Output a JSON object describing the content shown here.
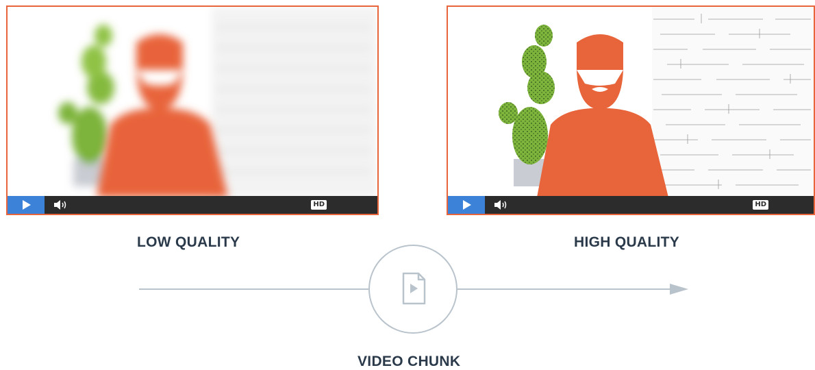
{
  "players": [
    {
      "id": "low",
      "hd_label": "HD"
    },
    {
      "id": "high",
      "hd_label": "HD"
    }
  ],
  "labels": {
    "low": "LOW QUALITY",
    "high": "HIGH QUALITY",
    "chunk": "VIDEO CHUNK"
  },
  "icons": {
    "play": "play-icon",
    "volume": "volume-icon",
    "video_file": "video-file-icon",
    "arrow": "arrow-right-icon"
  },
  "colors": {
    "accent_orange": "#e8643a",
    "cactus_green": "#7db43b",
    "play_blue": "#3c82d8",
    "control_bar": "#2c2c2c",
    "label_text": "#2b3a4a",
    "timeline_gray": "#b9c3cc"
  }
}
